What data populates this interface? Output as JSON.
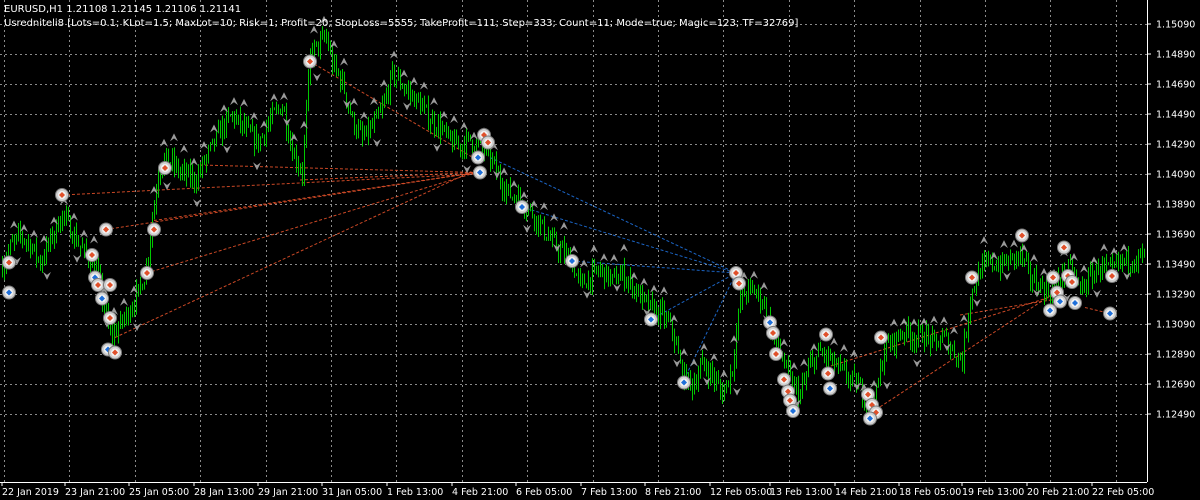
{
  "header": {
    "symbol_line": "EURUSD,H1  1.21108 1.21145 1.21106 1.21141",
    "expert_line": "Usredniteli8 [Lots=0.1; KLot=1.5; MaxLot=10; Risk=1; Profit=20; StopLoss=5555; TakeProfit=111; Step=333; Count=11; Mode=true; Magic=123; TF=32769]"
  },
  "colors": {
    "background": "#000000",
    "grid": "#8a8a8a",
    "candle": "#00c800",
    "text": "#ffffff",
    "buy_marker": "#1e6fd9",
    "sell_marker": "#e0502a",
    "buy_line": "#1e6fd9",
    "sell_line": "#e0502a",
    "fractal": "#9a9a9a"
  },
  "chart_data": {
    "type": "candlestick",
    "symbol": "EURUSD",
    "timeframe": "H1",
    "grid": true,
    "price_axis": [
      "1.15090",
      "1.14890",
      "1.14690",
      "1.14490",
      "1.14290",
      "1.14090",
      "1.13890",
      "1.13690",
      "1.13490",
      "1.13290",
      "1.13090",
      "1.12890",
      "1.12690",
      "1.12490"
    ],
    "time_axis": [
      "22 Jan 2019",
      "23 Jan 21:00",
      "25 Jan 05:00",
      "28 Jan 13:00",
      "29 Jan 21:00",
      "31 Jan 05:00",
      "1 Feb 13:00",
      "4 Feb 21:00",
      "6 Feb 05:00",
      "7 Feb 13:00",
      "8 Feb 21:00",
      "12 Feb 05:00",
      "13 Feb 13:00",
      "14 Feb 21:00",
      "18 Feb 05:00",
      "19 Feb 13:00",
      "20 Feb 21:00",
      "22 Feb 05:00"
    ],
    "ylim": [
      1.124,
      1.152
    ],
    "price_path": [
      [
        0,
        1.1345
      ],
      [
        10,
        1.136
      ],
      [
        20,
        1.1368
      ],
      [
        30,
        1.1362
      ],
      [
        40,
        1.135
      ],
      [
        55,
        1.1372
      ],
      [
        62,
        1.1382
      ],
      [
        72,
        1.137
      ],
      [
        82,
        1.1358
      ],
      [
        90,
        1.1352
      ],
      [
        96,
        1.1345
      ],
      [
        104,
        1.132
      ],
      [
        110,
        1.13
      ],
      [
        116,
        1.1305
      ],
      [
        126,
        1.1315
      ],
      [
        138,
        1.133
      ],
      [
        146,
        1.1345
      ],
      [
        152,
        1.138
      ],
      [
        158,
        1.141
      ],
      [
        166,
        1.142
      ],
      [
        180,
        1.141
      ],
      [
        195,
        1.1405
      ],
      [
        210,
        1.1425
      ],
      [
        222,
        1.144
      ],
      [
        232,
        1.1448
      ],
      [
        245,
        1.1438
      ],
      [
        258,
        1.143
      ],
      [
        270,
        1.1445
      ],
      [
        282,
        1.1455
      ],
      [
        292,
        1.1425
      ],
      [
        302,
        1.141
      ],
      [
        310,
        1.1488
      ],
      [
        318,
        1.1495
      ],
      [
        326,
        1.15
      ],
      [
        332,
        1.1482
      ],
      [
        342,
        1.147
      ],
      [
        352,
        1.1445
      ],
      [
        362,
        1.1432
      ],
      [
        372,
        1.144
      ],
      [
        382,
        1.1452
      ],
      [
        392,
        1.1475
      ],
      [
        400,
        1.147
      ],
      [
        410,
        1.1462
      ],
      [
        420,
        1.1455
      ],
      [
        430,
        1.1445
      ],
      [
        440,
        1.144
      ],
      [
        450,
        1.143
      ],
      [
        460,
        1.1428
      ],
      [
        470,
        1.1432
      ],
      [
        480,
        1.1428
      ],
      [
        490,
        1.142
      ],
      [
        500,
        1.1405
      ],
      [
        510,
        1.1395
      ],
      [
        520,
        1.1392
      ],
      [
        530,
        1.1385
      ],
      [
        540,
        1.1375
      ],
      [
        550,
        1.1365
      ],
      [
        560,
        1.1358
      ],
      [
        570,
        1.1352
      ],
      [
        580,
        1.1335
      ],
      [
        590,
        1.134
      ],
      [
        600,
        1.1345
      ],
      [
        612,
        1.1338
      ],
      [
        622,
        1.1342
      ],
      [
        632,
        1.1335
      ],
      [
        642,
        1.1325
      ],
      [
        652,
        1.1318
      ],
      [
        662,
        1.1315
      ],
      [
        672,
        1.1305
      ],
      [
        682,
        1.1275
      ],
      [
        692,
        1.1268
      ],
      [
        702,
        1.1282
      ],
      [
        712,
        1.1275
      ],
      [
        722,
        1.1262
      ],
      [
        732,
        1.128
      ],
      [
        740,
        1.1325
      ],
      [
        748,
        1.1332
      ],
      [
        756,
        1.133
      ],
      [
        764,
        1.1322
      ],
      [
        772,
        1.13
      ],
      [
        780,
        1.129
      ],
      [
        790,
        1.127
      ],
      [
        800,
        1.1262
      ],
      [
        810,
        1.1282
      ],
      [
        820,
        1.129
      ],
      [
        830,
        1.1285
      ],
      [
        840,
        1.1278
      ],
      [
        850,
        1.1272
      ],
      [
        858,
        1.1268
      ],
      [
        868,
        1.1255
      ],
      [
        876,
        1.1262
      ],
      [
        884,
        1.1292
      ],
      [
        894,
        1.1298
      ],
      [
        904,
        1.1305
      ],
      [
        914,
        1.13
      ],
      [
        924,
        1.1302
      ],
      [
        934,
        1.1295
      ],
      [
        944,
        1.13
      ],
      [
        954,
        1.129
      ],
      [
        962,
        1.1285
      ],
      [
        970,
        1.1328
      ],
      [
        980,
        1.1345
      ],
      [
        990,
        1.135
      ],
      [
        1000,
        1.1348
      ],
      [
        1010,
        1.1352
      ],
      [
        1020,
        1.1355
      ],
      [
        1030,
        1.134
      ],
      [
        1040,
        1.1335
      ],
      [
        1050,
        1.133
      ],
      [
        1060,
        1.134
      ],
      [
        1070,
        1.1345
      ],
      [
        1080,
        1.1332
      ],
      [
        1090,
        1.134
      ],
      [
        1100,
        1.1348
      ],
      [
        1110,
        1.1343
      ],
      [
        1120,
        1.135
      ],
      [
        1130,
        1.1352
      ],
      [
        1145,
        1.1355
      ]
    ],
    "trade_markers": [
      {
        "x": 9,
        "price": 1.135,
        "side": "sell"
      },
      {
        "x": 9,
        "price": 1.133,
        "side": "buy"
      },
      {
        "x": 62,
        "price": 1.1395,
        "side": "sell"
      },
      {
        "x": 92,
        "price": 1.1355,
        "side": "sell"
      },
      {
        "x": 95,
        "price": 1.134,
        "side": "buy"
      },
      {
        "x": 98,
        "price": 1.1335,
        "side": "sell"
      },
      {
        "x": 102,
        "price": 1.1326,
        "side": "buy"
      },
      {
        "x": 106,
        "price": 1.1372,
        "side": "sell"
      },
      {
        "x": 110,
        "price": 1.1335,
        "side": "sell"
      },
      {
        "x": 110,
        "price": 1.1313,
        "side": "sell"
      },
      {
        "x": 108,
        "price": 1.1292,
        "side": "buy"
      },
      {
        "x": 115,
        "price": 1.129,
        "side": "sell"
      },
      {
        "x": 147,
        "price": 1.1343,
        "side": "sell"
      },
      {
        "x": 154,
        "price": 1.1372,
        "side": "sell"
      },
      {
        "x": 165,
        "price": 1.1413,
        "side": "sell"
      },
      {
        "x": 310,
        "price": 1.1484,
        "side": "sell"
      },
      {
        "x": 478,
        "price": 1.142,
        "side": "buy"
      },
      {
        "x": 480,
        "price": 1.141,
        "side": "buy"
      },
      {
        "x": 484,
        "price": 1.1435,
        "side": "sell"
      },
      {
        "x": 488,
        "price": 1.143,
        "side": "sell"
      },
      {
        "x": 522,
        "price": 1.1387,
        "side": "buy"
      },
      {
        "x": 572,
        "price": 1.1351,
        "side": "buy"
      },
      {
        "x": 651,
        "price": 1.1312,
        "side": "buy"
      },
      {
        "x": 684,
        "price": 1.127,
        "side": "buy"
      },
      {
        "x": 736,
        "price": 1.1343,
        "side": "sell"
      },
      {
        "x": 739,
        "price": 1.1336,
        "side": "sell"
      },
      {
        "x": 770,
        "price": 1.131,
        "side": "buy"
      },
      {
        "x": 773,
        "price": 1.1303,
        "side": "sell"
      },
      {
        "x": 776,
        "price": 1.1289,
        "side": "sell"
      },
      {
        "x": 784,
        "price": 1.1272,
        "side": "sell"
      },
      {
        "x": 788,
        "price": 1.1264,
        "side": "sell"
      },
      {
        "x": 790,
        "price": 1.1258,
        "side": "sell"
      },
      {
        "x": 793,
        "price": 1.1251,
        "side": "buy"
      },
      {
        "x": 826,
        "price": 1.1302,
        "side": "sell"
      },
      {
        "x": 828,
        "price": 1.1276,
        "side": "sell"
      },
      {
        "x": 830,
        "price": 1.1266,
        "side": "buy"
      },
      {
        "x": 868,
        "price": 1.1262,
        "side": "sell"
      },
      {
        "x": 872,
        "price": 1.1255,
        "side": "sell"
      },
      {
        "x": 876,
        "price": 1.125,
        "side": "sell"
      },
      {
        "x": 870,
        "price": 1.1246,
        "side": "buy"
      },
      {
        "x": 881,
        "price": 1.13,
        "side": "sell"
      },
      {
        "x": 972,
        "price": 1.134,
        "side": "sell"
      },
      {
        "x": 1022,
        "price": 1.1368,
        "side": "sell"
      },
      {
        "x": 1050,
        "price": 1.1318,
        "side": "buy"
      },
      {
        "x": 1053,
        "price": 1.134,
        "side": "sell"
      },
      {
        "x": 1057,
        "price": 1.133,
        "side": "sell"
      },
      {
        "x": 1060,
        "price": 1.1324,
        "side": "buy"
      },
      {
        "x": 1064,
        "price": 1.136,
        "side": "sell"
      },
      {
        "x": 1068,
        "price": 1.1341,
        "side": "sell"
      },
      {
        "x": 1072,
        "price": 1.1337,
        "side": "sell"
      },
      {
        "x": 1075,
        "price": 1.1323,
        "side": "buy"
      },
      {
        "x": 1112,
        "price": 1.1341,
        "side": "sell"
      },
      {
        "x": 1110,
        "price": 1.1316,
        "side": "buy"
      }
    ],
    "trade_lines": [
      {
        "from": [
          62,
          1.1395
        ],
        "to": [
          476,
          1.1409
        ],
        "side": "sell"
      },
      {
        "from": [
          106,
          1.1372
        ],
        "to": [
          476,
          1.141
        ],
        "side": "sell"
      },
      {
        "from": [
          115,
          1.13
        ],
        "to": [
          476,
          1.1412
        ],
        "side": "sell"
      },
      {
        "from": [
          147,
          1.1343
        ],
        "to": [
          476,
          1.141
        ],
        "side": "sell"
      },
      {
        "from": [
          154,
          1.1378
        ],
        "to": [
          476,
          1.141
        ],
        "side": "sell"
      },
      {
        "from": [
          200,
          1.1415
        ],
        "to": [
          476,
          1.141
        ],
        "side": "sell"
      },
      {
        "from": [
          300,
          1.1405
        ],
        "to": [
          476,
          1.141
        ],
        "side": "sell"
      },
      {
        "from": [
          310,
          1.1484
        ],
        "to": [
          478,
          1.1418
        ],
        "side": "sell"
      },
      {
        "from": [
          490,
          1.142
        ],
        "to": [
          736,
          1.1343
        ],
        "side": "buy"
      },
      {
        "from": [
          522,
          1.1387
        ],
        "to": [
          736,
          1.1343
        ],
        "side": "buy"
      },
      {
        "from": [
          572,
          1.1351
        ],
        "to": [
          736,
          1.1343
        ],
        "side": "buy"
      },
      {
        "from": [
          651,
          1.1312
        ],
        "to": [
          736,
          1.1343
        ],
        "side": "buy"
      },
      {
        "from": [
          684,
          1.1272
        ],
        "to": [
          736,
          1.1343
        ],
        "side": "buy"
      },
      {
        "from": [
          876,
          1.1252
        ],
        "to": [
          1055,
          1.133
        ],
        "side": "sell"
      },
      {
        "from": [
          826,
          1.128
        ],
        "to": [
          1055,
          1.1328
        ],
        "side": "sell"
      },
      {
        "from": [
          960,
          1.1315
        ],
        "to": [
          1060,
          1.1326
        ],
        "side": "sell"
      },
      {
        "from": [
          1085,
          1.132
        ],
        "to": [
          1110,
          1.1316
        ],
        "side": "sell"
      }
    ]
  }
}
